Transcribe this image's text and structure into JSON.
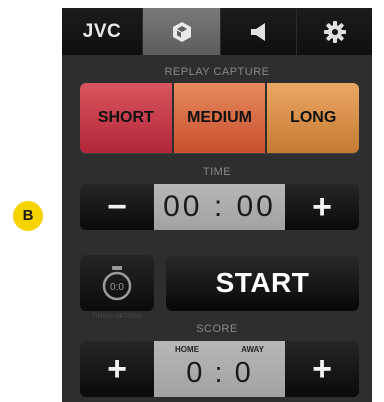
{
  "marker": {
    "label": "B"
  },
  "header": {
    "logo": "JVC",
    "tabs": [
      {
        "name": "replay",
        "icon": "replay-cube-icon",
        "active": true
      },
      {
        "name": "audio",
        "icon": "speaker-icon",
        "active": false
      },
      {
        "name": "settings",
        "icon": "gear-icon",
        "active": false
      }
    ]
  },
  "replay_capture": {
    "label": "REPLAY CAPTURE",
    "options": [
      "SHORT",
      "MEDIUM",
      "LONG"
    ],
    "colors": {
      "short": "#c73a48",
      "medium": "#d96b44",
      "long": "#d98e48"
    }
  },
  "time": {
    "label": "TIME",
    "value": "00 : 00",
    "decrement": "−",
    "increment": "+"
  },
  "timer": {
    "icon": "stopwatch-icon",
    "display": "0:0",
    "caption": "TIMING OPTIONS"
  },
  "start": {
    "label": "START"
  },
  "score": {
    "label": "SCORE",
    "home_label": "HOME",
    "away_label": "AWAY",
    "value": "0 : 0",
    "home_increment": "+",
    "away_increment": "+"
  }
}
